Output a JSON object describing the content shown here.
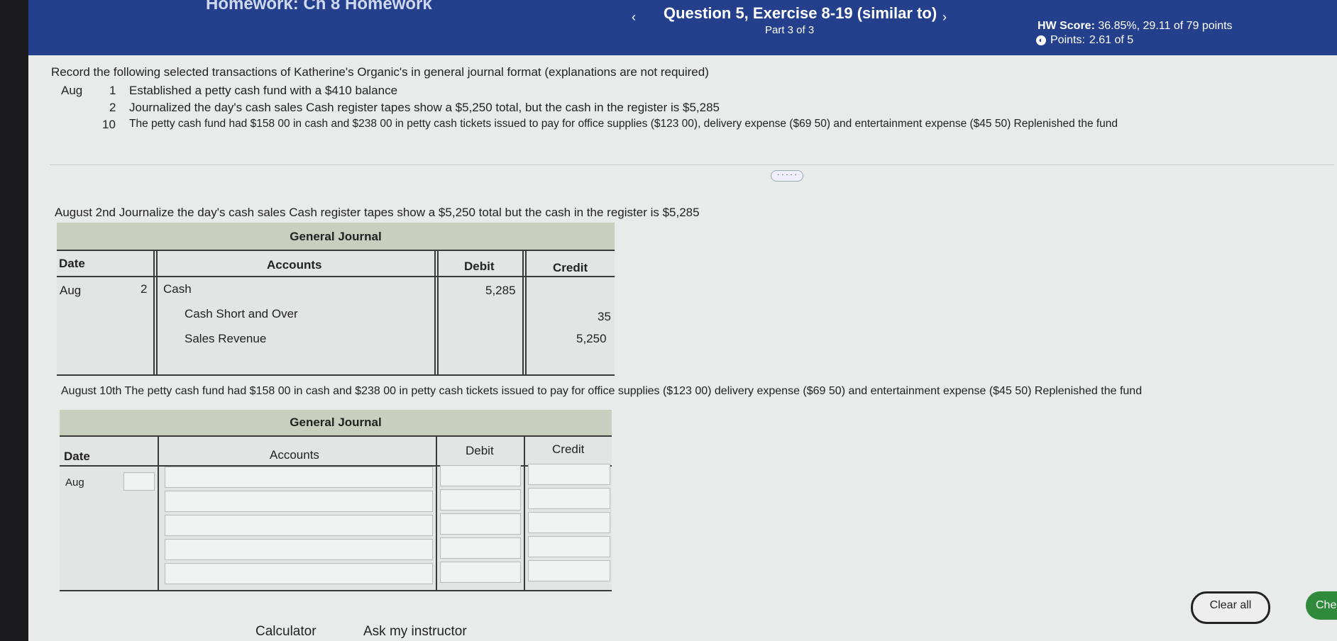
{
  "header": {
    "hw_title": "Homework: Ch 8 Homework",
    "question_title": "Question 5, Exercise 8-19 (similar to)",
    "part": "Part 3 of 3",
    "hw_score_label": "HW Score:",
    "hw_score_value": "36.85%, 29.11 of 79 points",
    "points_label": "Points:",
    "points_value": "2.61 of 5",
    "prev_glyph": "‹",
    "next_glyph": "›"
  },
  "problem": {
    "intro": "Record the following selected transactions of Katherine's Organic's in general journal format (explanations are not required)",
    "month": "Aug",
    "transactions": [
      {
        "day": "1",
        "text": "Established a petty cash fund with a $410 balance"
      },
      {
        "day": "2",
        "text": "Journalized the day's cash sales  Cash register tapes show a $5,250 total, but the cash in the register is $5,285"
      },
      {
        "day": "10",
        "text": "The petty cash fund had $158 00 in cash and $238 00 in petty cash tickets issued to pay for office supplies ($123 00), delivery expense ($69 50)  and entertainment expense ($45 50)  Replenished the fund"
      }
    ],
    "more_label": "· · · · ·"
  },
  "journal1": {
    "prompt": "August 2nd  Journalize the day's cash sales  Cash register tapes show a $5,250 total  but the cash in the register is $5,285",
    "title": "General Journal",
    "headers": {
      "date": "Date",
      "accounts": "Accounts",
      "debit": "Debit",
      "credit": "Credit"
    },
    "month": "Aug",
    "day": "2",
    "rows": [
      {
        "account": "Cash",
        "debit": "5,285",
        "credit": ""
      },
      {
        "account": "Cash Short and Over",
        "debit": "",
        "credit": "35"
      },
      {
        "account": "Sales Revenue",
        "debit": "",
        "credit": "5,250"
      }
    ]
  },
  "journal2": {
    "prompt": "August 10th  The petty cash fund had $158 00 in cash and $238 00 in petty cash tickets issued to pay for office supplies ($123 00)  delivery expense ($69 50)  and entertainment expense ($45 50)  Replenished the fund",
    "title": "General Journal",
    "headers": {
      "date": "Date",
      "accounts": "Accounts",
      "debit": "Debit",
      "credit": "Credit"
    },
    "month": "Aug"
  },
  "footer": {
    "clear_all": "Clear all",
    "check": "Check",
    "calculator": "Calculator",
    "ask_instructor": "Ask my instructor"
  }
}
